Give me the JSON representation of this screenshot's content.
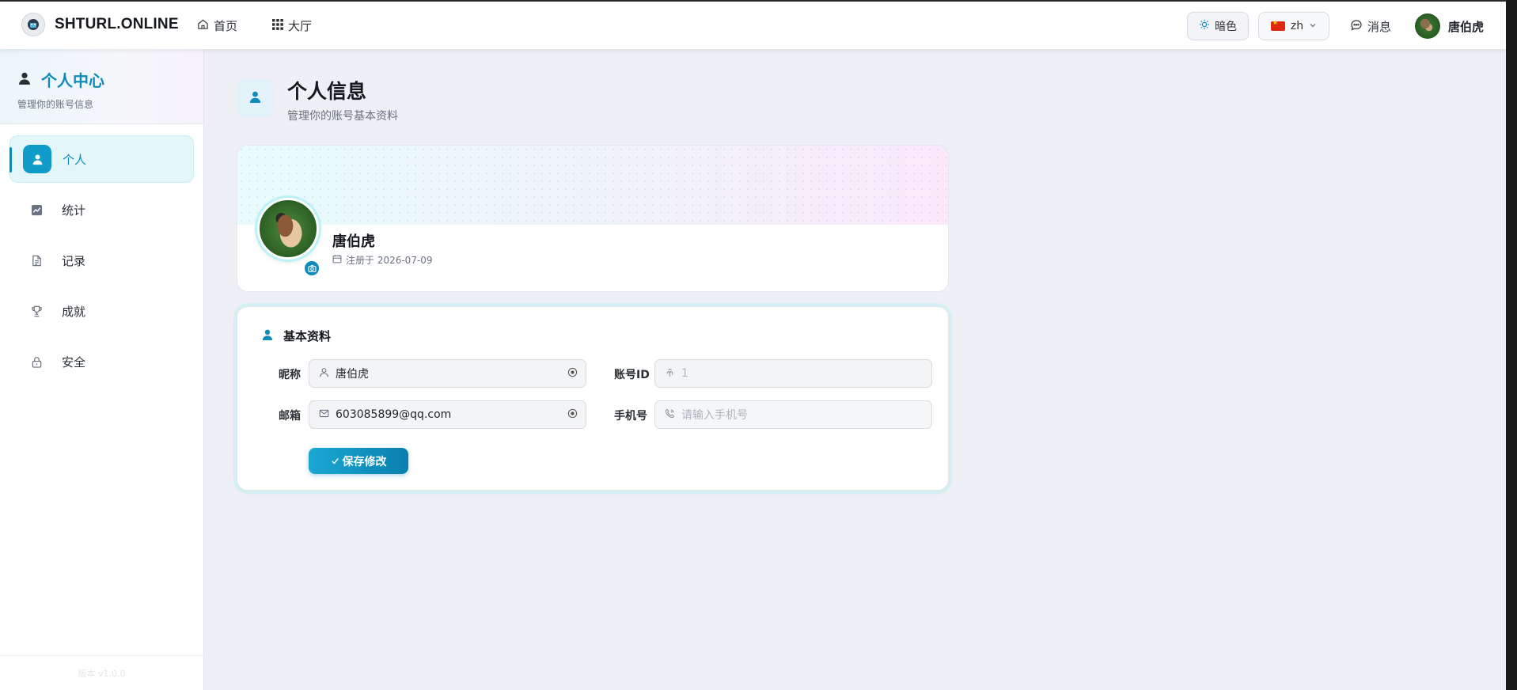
{
  "header": {
    "brand": "SHTURL.ONLINE",
    "nav": [
      {
        "label": "首页",
        "icon": "home-icon"
      },
      {
        "label": "大厅",
        "icon": "grid-icon"
      }
    ],
    "theme_label": "暗色",
    "lang_label": "zh",
    "messages_label": "消息",
    "user_name": "唐伯虎"
  },
  "sidebar": {
    "title": "个人中心",
    "subtitle": "管理你的账号信息",
    "items": [
      {
        "label": "个人",
        "icon": "user-icon",
        "active": true
      },
      {
        "label": "统计",
        "icon": "chart-icon",
        "active": false
      },
      {
        "label": "记录",
        "icon": "document-icon",
        "active": false
      },
      {
        "label": "成就",
        "icon": "trophy-icon",
        "active": false
      },
      {
        "label": "安全",
        "icon": "lock-icon",
        "active": false
      }
    ],
    "footer": "版本 v1.0.0"
  },
  "page": {
    "title": "个人信息",
    "subtitle": "管理你的账号基本资料"
  },
  "profile": {
    "name": "唐伯虎",
    "registered": "注册于 2026-07-09"
  },
  "form": {
    "title": "基本资料",
    "nickname_label": "昵称",
    "nickname_value": "唐伯虎",
    "account_id_label": "账号ID",
    "account_id_value": "1",
    "email_label": "邮箱",
    "email_value": "603085899@qq.com",
    "phone_label": "手机号",
    "phone_placeholder": "请输入手机号",
    "save_label": "保存修改"
  },
  "colors": {
    "accent": "#0e8bb8",
    "background": "#eef0f5"
  }
}
